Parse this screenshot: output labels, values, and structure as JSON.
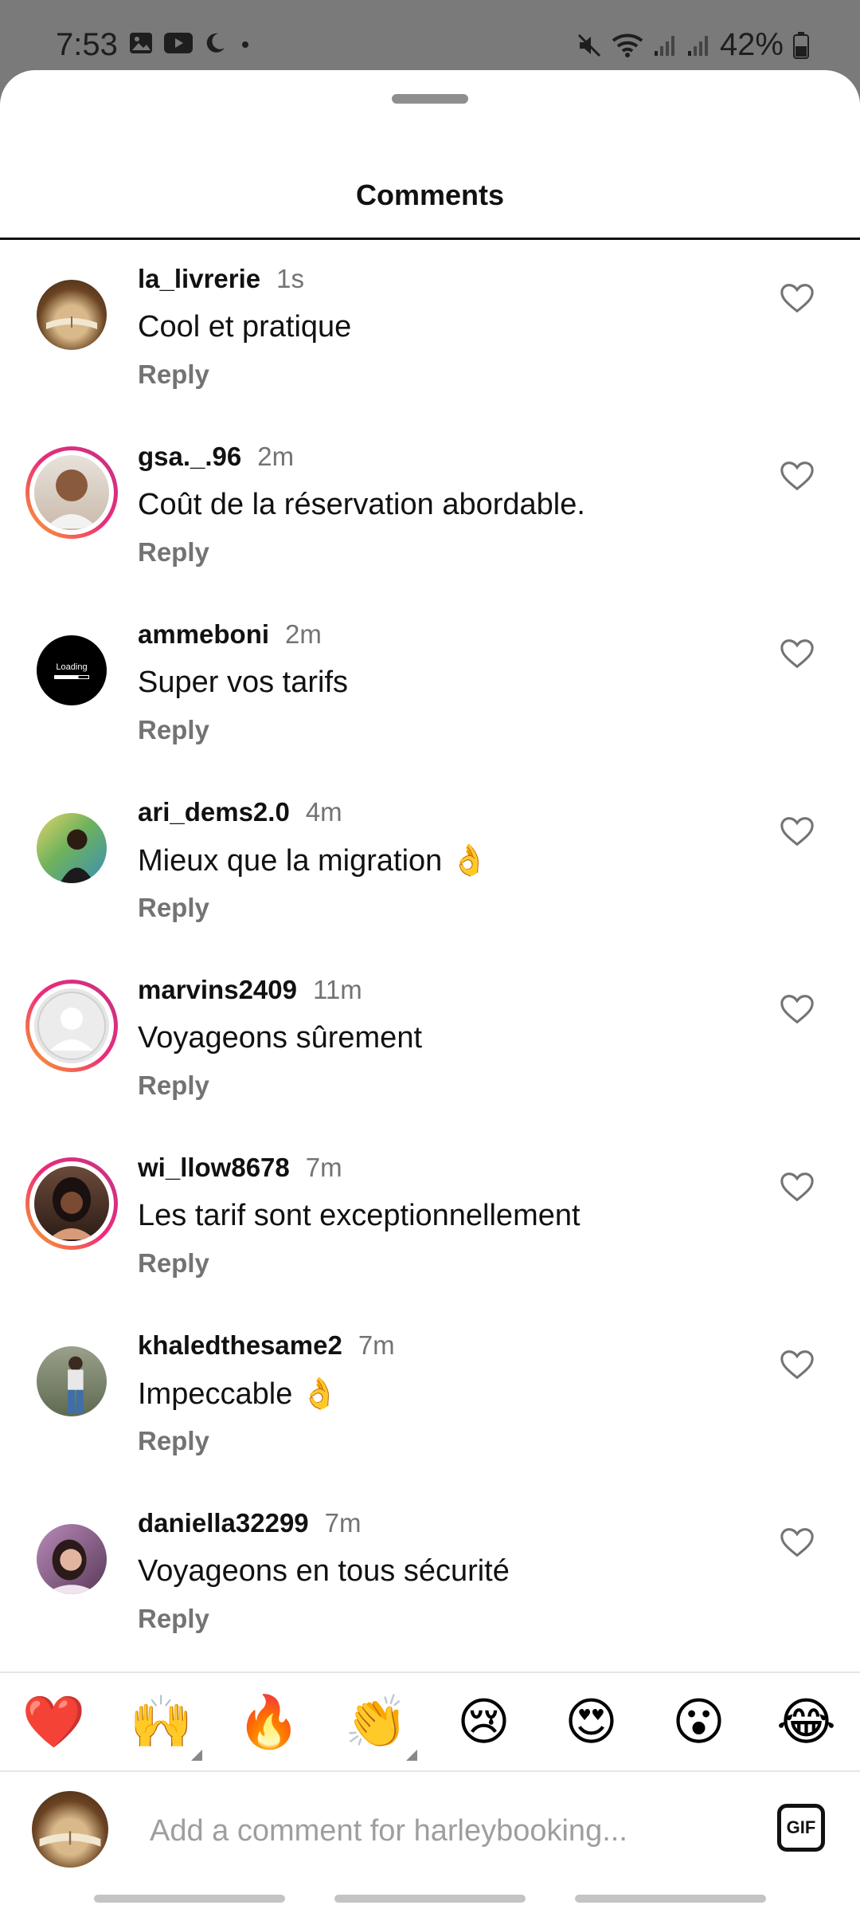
{
  "status_bar": {
    "time": "7:53",
    "battery": "42%",
    "left_icons": [
      "image-icon",
      "youtube-icon",
      "moon-icon",
      "dot-icon"
    ],
    "right_icons": [
      "mute-icon",
      "wifi-icon",
      "signal-icon",
      "signal-icon",
      "battery-icon"
    ]
  },
  "sheet": {
    "title": "Comments"
  },
  "comments": [
    {
      "username": "la_livrerie",
      "time": "1s",
      "text": "Cool et pratique",
      "reply": "Reply"
    },
    {
      "username": "gsa._.96",
      "time": "2m",
      "text": "Coût de la réservation abordable.",
      "reply": "Reply"
    },
    {
      "username": "ammeboni",
      "time": "2m",
      "text": "Super vos tarifs",
      "reply": "Reply"
    },
    {
      "username": "ari_dems2.0",
      "time": "4m",
      "text": "Mieux que la migration 👌",
      "reply": "Reply"
    },
    {
      "username": "marvins2409",
      "time": "11m",
      "text": "Voyageons sûrement",
      "reply": "Reply"
    },
    {
      "username": "wi_llow8678",
      "time": "7m",
      "text": "Les tarif sont exceptionnellement",
      "reply": "Reply"
    },
    {
      "username": "khaledthesame2",
      "time": "7m",
      "text": "Impeccable 👌",
      "reply": "Reply"
    },
    {
      "username": "daniella32299",
      "time": "7m",
      "text": "Voyageons en tous sécurité",
      "reply": "Reply"
    }
  ],
  "avatar_badge": {
    "loading_text": "Loading"
  },
  "emoji_bar": [
    "❤️",
    "🙌",
    "🔥",
    "👏",
    "😢",
    "😍",
    "😮",
    "😂"
  ],
  "composer": {
    "placeholder": "Add a comment for harleybooking...",
    "gif_label": "GIF"
  },
  "colors": {
    "story_ring_start": "#f9a825",
    "story_ring_end": "#c13584",
    "heart_outline": "#737373",
    "secondary_text": "#737373"
  }
}
